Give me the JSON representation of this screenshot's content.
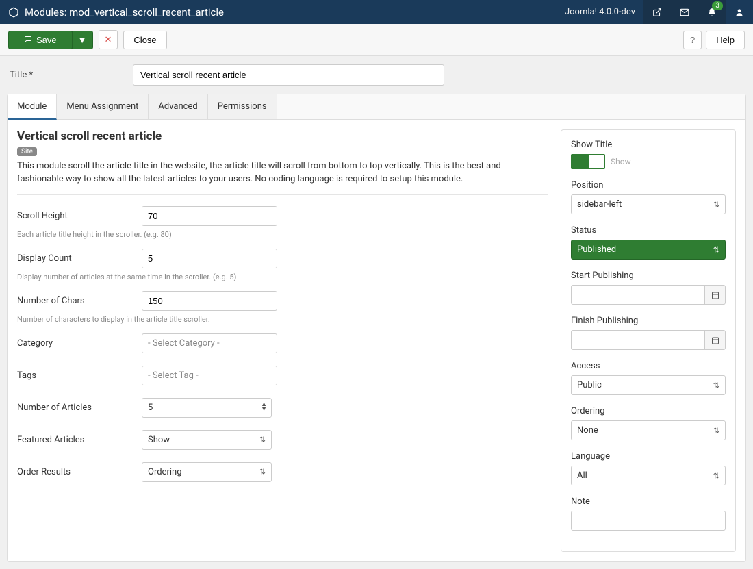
{
  "topbar": {
    "title": "Modules: mod_vertical_scroll_recent_article",
    "version": "Joomla! 4.0.0-dev",
    "notification_count": "3"
  },
  "toolbar": {
    "save": "Save",
    "close": "Close",
    "help": "Help"
  },
  "title_row": {
    "label": "Title *",
    "value": "Vertical scroll recent article"
  },
  "tabs": {
    "module": "Module",
    "menu": "Menu Assignment",
    "advanced": "Advanced",
    "permissions": "Permissions"
  },
  "module": {
    "heading": "Vertical scroll recent article",
    "site_badge": "Site",
    "description": "This module scroll the article title in the website, the article title will scroll from bottom to top vertically. This is the best and fashionable way to show all the latest articles to your users. No coding language is required to setup this module.",
    "scroll_height": {
      "label": "Scroll Height",
      "value": "70",
      "help": "Each article title height in the scroller. (e.g. 80)"
    },
    "display_count": {
      "label": "Display Count",
      "value": "5",
      "help": "Display number of articles at the same time in the scroller. (e.g. 5)"
    },
    "num_chars": {
      "label": "Number of Chars",
      "value": "150",
      "help": "Number of characters to display in the article title scroller."
    },
    "category": {
      "label": "Category",
      "placeholder": "- Select Category -"
    },
    "tags": {
      "label": "Tags",
      "placeholder": "- Select Tag -"
    },
    "num_articles": {
      "label": "Number of Articles",
      "value": "5"
    },
    "featured": {
      "label": "Featured Articles",
      "value": "Show"
    },
    "order": {
      "label": "Order Results",
      "value": "Ordering"
    }
  },
  "sidebar": {
    "show_title": {
      "label": "Show Title",
      "text": "Show"
    },
    "position": {
      "label": "Position",
      "value": "sidebar-left"
    },
    "status": {
      "label": "Status",
      "value": "Published"
    },
    "start_pub": {
      "label": "Start Publishing",
      "value": ""
    },
    "finish_pub": {
      "label": "Finish Publishing",
      "value": ""
    },
    "access": {
      "label": "Access",
      "value": "Public"
    },
    "ordering": {
      "label": "Ordering",
      "value": "None"
    },
    "language": {
      "label": "Language",
      "value": "All"
    },
    "note": {
      "label": "Note",
      "value": ""
    }
  }
}
